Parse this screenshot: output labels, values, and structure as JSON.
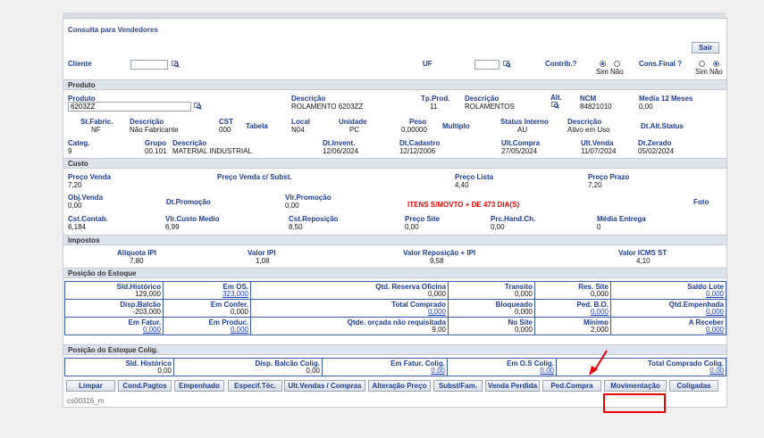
{
  "title": "Consulta para Vendedores",
  "sair": "Sair",
  "top": {
    "cliente_label": "Cliente",
    "cliente_value": "",
    "uf_label": "UF",
    "uf_value": "",
    "contrib_label": "Contrib.?",
    "cons_final_label": "Cons.Final ?",
    "sim": "Sim",
    "nao": "Não",
    "contrib_selected": "Sim",
    "cons_final_selected": "Não"
  },
  "produto": {
    "section": "Produto",
    "produto_label": "Produto",
    "produto_value": "6203ZZ",
    "descricao_label": "Descrição",
    "descricao_value": "ROLAMENTO 6203ZZ",
    "tp_prod_label": "Tp.Prod.",
    "tp_prod_value": "11",
    "descricao2_label": "Descrição",
    "descricao2_value": "ROLAMENTOS",
    "alt_label": "Alt.",
    "ncm_label": "NCM",
    "ncm_value": "84821010",
    "media12_label": "Media 12 Meses",
    "media12_value": "0,00",
    "st_fabric_label": "St.Fabric.",
    "st_fabric_value": "NF",
    "descricao3_label": "Descrição",
    "descricao3_value": "Não Fabricante",
    "cst_label": "CST",
    "cst_value": "000",
    "tabela_label": "Tabela",
    "local_label": "Local",
    "local_value": "N04",
    "unidade_label": "Unidade",
    "unidade_value": "PC",
    "peso_label": "Peso",
    "peso_value": "0,00000",
    "multiplo_label": "Multiplo",
    "status_label": "Status Interno",
    "status_value": "AU",
    "descricao4_label": "Descrição",
    "descricao4_value": "Ativo em Uso",
    "dt_alt_status_label": "Dt.Alt.Status",
    "categ_label": "Categ.",
    "categ_value": "9",
    "grupo_label": "Grupo",
    "grupo_value": "00.101",
    "descricao5_label": "Descrição",
    "descricao5_value": "MATERIAL INDUSTRIAL",
    "dt_invent_label": "Dt.Invent.",
    "dt_invent_value": "12/06/2024",
    "dt_cadastro_label": "Dt.Cadastro",
    "dt_cadastro_value": "12/12/2006",
    "ult_compra_label": "Ult.Compra",
    "ult_compra_value": "27/05/2024",
    "ult_venda_label": "Ult.Venda",
    "ult_venda_value": "11/07/2024",
    "dt_zerado_label": "Dt.Zerado",
    "dt_zerado_value": "05/02/2024"
  },
  "custo": {
    "section": "Custo",
    "preco_venda_label": "Preço Venda",
    "preco_venda_value": "7,20",
    "preco_venda_subst_label": "Preço Venda c/ Subst.",
    "preco_venda_subst_value": "",
    "preco_lista_label": "Preço Lista",
    "preco_lista_value": "4,40",
    "preco_prazo_label": "Preço Prazo",
    "preco_prazo_value": "7,20",
    "obj_venda_label": "Obj.Venda",
    "obj_venda_value": "0,00",
    "dt_promocao_label": "Dt.Promoção",
    "vlr_promocao_label": "Vlr.Promoção",
    "vlr_promocao_value": "0,00",
    "alert": "ITENS S/MOVTO + DE 473 DIA(S)",
    "foto_label": "Foto",
    "cst_contab_label": "Cst.Contab.",
    "cst_contab_value": "6,184",
    "vlr_custo_medio_label": "Vlr.Custo Medio",
    "vlr_custo_medio_value": "6,99",
    "cst_reposicao_label": "Cst.Reposição",
    "cst_reposicao_value": "8,50",
    "preco_site_label": "Preço Site",
    "preco_site_value": "0,00",
    "prc_hand_label": "Prc.Hand.Ch.",
    "prc_hand_value": "0,00",
    "media_entrega_label": "Média Entrega",
    "media_entrega_value": "0"
  },
  "impostos": {
    "section": "Impostos",
    "aliquota_ipi_label": "Alíquota IPI",
    "aliquota_ipi_value": "7,80",
    "valor_ipi_label": "Valor IPI",
    "valor_ipi_value": "1,08",
    "valor_reposicao_label": "Valor Reposição + IPI",
    "valor_reposicao_value": "9,58",
    "valor_icms_label": "Valor ICMS ST",
    "valor_icms_value": "4,10"
  },
  "estoque": {
    "section": "Posição do Estoque",
    "rows": [
      [
        {
          "label": "Sld.Histórico",
          "value": "129,000",
          "link": false
        },
        {
          "label": "Em OS.",
          "value": "323,000",
          "link": true
        },
        {
          "label": "Qtd. Reserva Oficina",
          "value": "0,000",
          "link": false
        },
        {
          "label": "Transito",
          "value": "0,000",
          "link": false
        },
        {
          "label": "Res. Site",
          "value": "0,000",
          "link": false
        },
        {
          "label": "Saldo Lote",
          "value": "0,000",
          "link": true
        }
      ],
      [
        {
          "label": "Disp.Balcão",
          "value": "-203,000",
          "link": false
        },
        {
          "label": "Em Confer.",
          "value": "0,000",
          "link": false
        },
        {
          "label": "Total Comprado",
          "value": "0,000",
          "link": true
        },
        {
          "label": "Bloqueado",
          "value": "0,000",
          "link": false
        },
        {
          "label": "Ped. B.O.",
          "value": "0,000",
          "link": true
        },
        {
          "label": "Qtd.Empenhada",
          "value": "0,000",
          "link": true
        }
      ],
      [
        {
          "label": "Em Fatur.",
          "value": "0,000",
          "link": true
        },
        {
          "label": "Em Produc.",
          "value": "0,000",
          "link": true
        },
        {
          "label": "Qtde. orçada não requisitada",
          "value": "9,00",
          "link": false
        },
        {
          "label": "No Site",
          "value": "0,000",
          "link": false
        },
        {
          "label": "Mínimo",
          "value": "2,000",
          "link": false
        },
        {
          "label": "A Receber",
          "value": "0,000",
          "link": true
        }
      ]
    ]
  },
  "coligadas": {
    "section": "Posição do Estoque Colig.",
    "cells": [
      {
        "label": "Sld. Histórico",
        "value": "0,00",
        "link": false
      },
      {
        "label": "Disp. Balcão Colig.",
        "value": "0,00",
        "link": false
      },
      {
        "label": "Em Fatur. Colig.",
        "value": "0,00",
        "link": true
      },
      {
        "label": "Em O.S Colig.",
        "value": "0,00",
        "link": true
      },
      {
        "label": "Total Comprado Colig.",
        "value": "0,00",
        "link": true
      }
    ]
  },
  "buttons": [
    "Limpar",
    "Cond.Pagtos",
    "Empenhado",
    "Especif.Téc.",
    "Ult.Vendas / Compras",
    "Alteração Preço",
    "Subst/Fam.",
    "Venda Perdida",
    "Ped.Compra",
    "Movimentação",
    "Coligadas"
  ],
  "footer": "cs00316_m",
  "colors": {
    "label": "#1b3c95",
    "alert": "#ee0000",
    "highlight": "#ee0000"
  }
}
